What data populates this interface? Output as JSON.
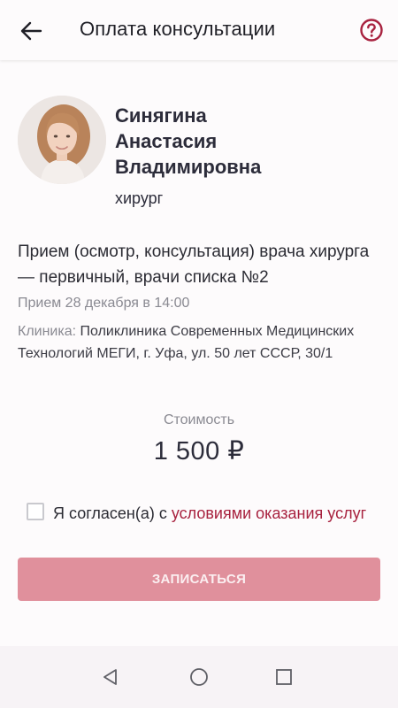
{
  "appbar": {
    "title": "Оплата консультации",
    "back_icon": "arrow-left-icon",
    "help_icon": "question-circle-icon"
  },
  "doctor": {
    "name_lines": [
      "Синягина",
      "Анастасия",
      "Владимировна"
    ],
    "specialty": "хирург"
  },
  "service": {
    "title": "Прием (осмотр, консультация) врача хирурга — первичный, врачи списка №2",
    "date": "Прием 28 декабря в 14:00",
    "clinic_label": "Клиника:",
    "clinic_value": "Поликлиника Современных Медицинских Технологий МЕГИ, г. Уфа, ул. 50 лет СССР, 30/1"
  },
  "price": {
    "label": "Стоимость",
    "value": "1 500 ₽"
  },
  "agreement": {
    "checked": false,
    "text": "Я согласен(а) с ",
    "link": "условиями оказания услуг"
  },
  "submit": {
    "label": "ЗАПИСАТЬСЯ"
  },
  "navbar": {
    "back_icon": "triangle-back-icon",
    "home_icon": "circle-home-icon",
    "recents_icon": "square-recents-icon"
  },
  "colors": {
    "accent": "#a8223f",
    "button_disabled": "#e0909c",
    "background": "#fdfbfc"
  }
}
